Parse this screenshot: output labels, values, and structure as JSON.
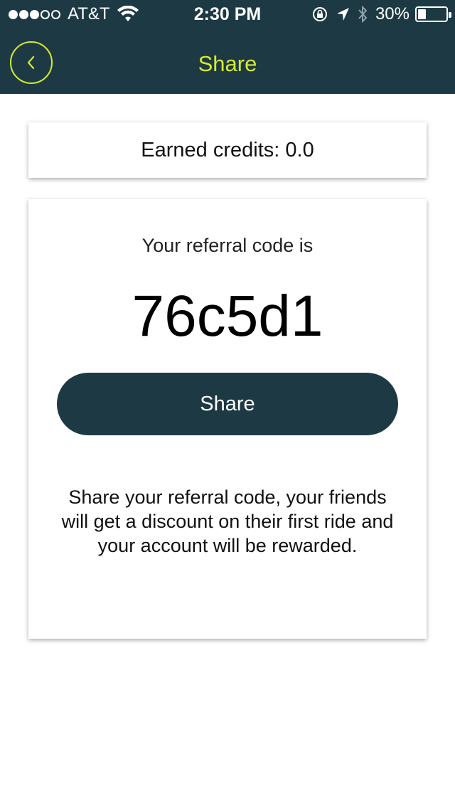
{
  "status_bar": {
    "signal_dots": [
      true,
      true,
      true,
      false,
      false
    ],
    "carrier": "AT&T",
    "time": "2:30 PM",
    "battery_percent_label": "30%",
    "battery_level": 0.3
  },
  "nav": {
    "title": "Share",
    "accent_color": "#d6ea2e",
    "background_color": "#1d3a44"
  },
  "credits": {
    "label": "Earned credits: 0.0"
  },
  "referral": {
    "label": "Your referral code is",
    "code": "76c5d1",
    "share_button_label": "Share",
    "description": "Share your referral code, your friends will get a discount on their first ride and your account will be rewarded."
  }
}
